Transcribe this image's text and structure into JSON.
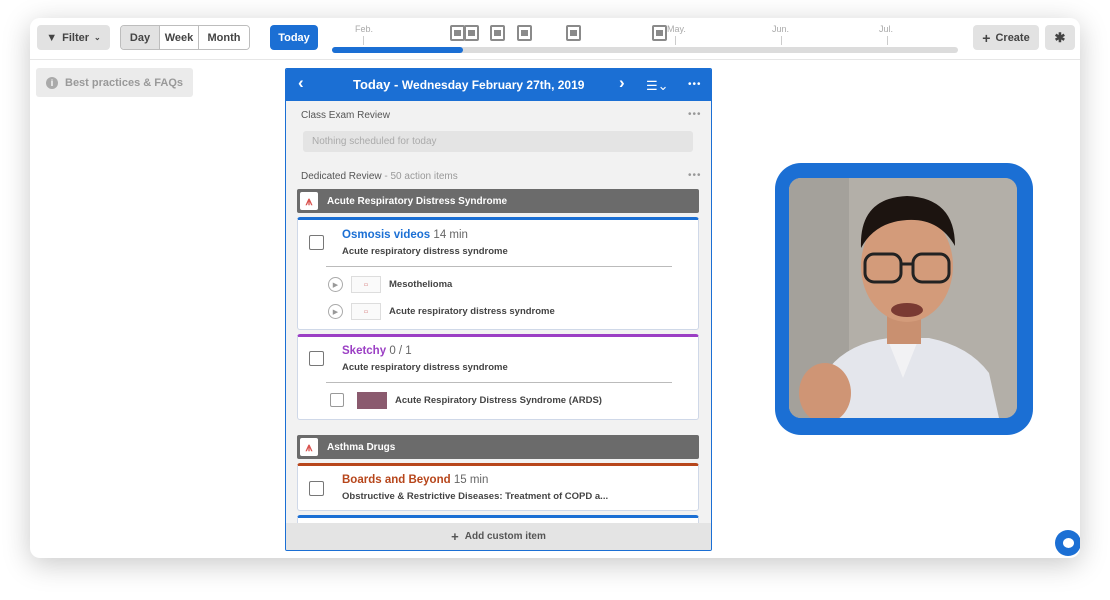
{
  "toolbar": {
    "filter_label": "Filter",
    "views": [
      "Day",
      "Week",
      "Month"
    ],
    "active_view": "Day",
    "today_label": "Today",
    "create_label": "Create"
  },
  "timeline": {
    "months": [
      "Feb.",
      "May.",
      "Jun.",
      "Jul."
    ],
    "progress": 0.21
  },
  "sidebar": {
    "best_practices_label": "Best practices & FAQs"
  },
  "panel": {
    "title_prefix": "Today",
    "title_date": "Wednesday February 27th, 2019",
    "class_exam_label": "Class Exam Review",
    "empty_text": "Nothing scheduled for today",
    "dedicated_label": "Dedicated Review",
    "dedicated_count": "- 50 action items",
    "topics": [
      "Acute Respiratory Distress Syndrome",
      "Asthma Drugs"
    ],
    "osmosis": {
      "title": "Osmosis videos",
      "duration": "14 min",
      "subtitle": "Acute respiratory distress syndrome",
      "videos": [
        "Mesothelioma",
        "Acute respiratory distress syndrome"
      ]
    },
    "sketchy": {
      "title": "Sketchy",
      "count": "0 / 1",
      "subtitle": "Acute respiratory distress syndrome",
      "item": "Acute Respiratory Distress Syndrome (ARDS)"
    },
    "boards": {
      "title": "Boards and Beyond",
      "duration": "15 min",
      "subtitle": "Obstructive & Restrictive Diseases: Treatment of COPD a..."
    },
    "add_custom_label": "Add custom item"
  },
  "colors": {
    "accent": "#1b6fd4",
    "osmosis": "#1b6fd4",
    "sketchy": "#9b3fc4",
    "boards": "#b7461b",
    "topic_bar": "#6b6b6b"
  }
}
